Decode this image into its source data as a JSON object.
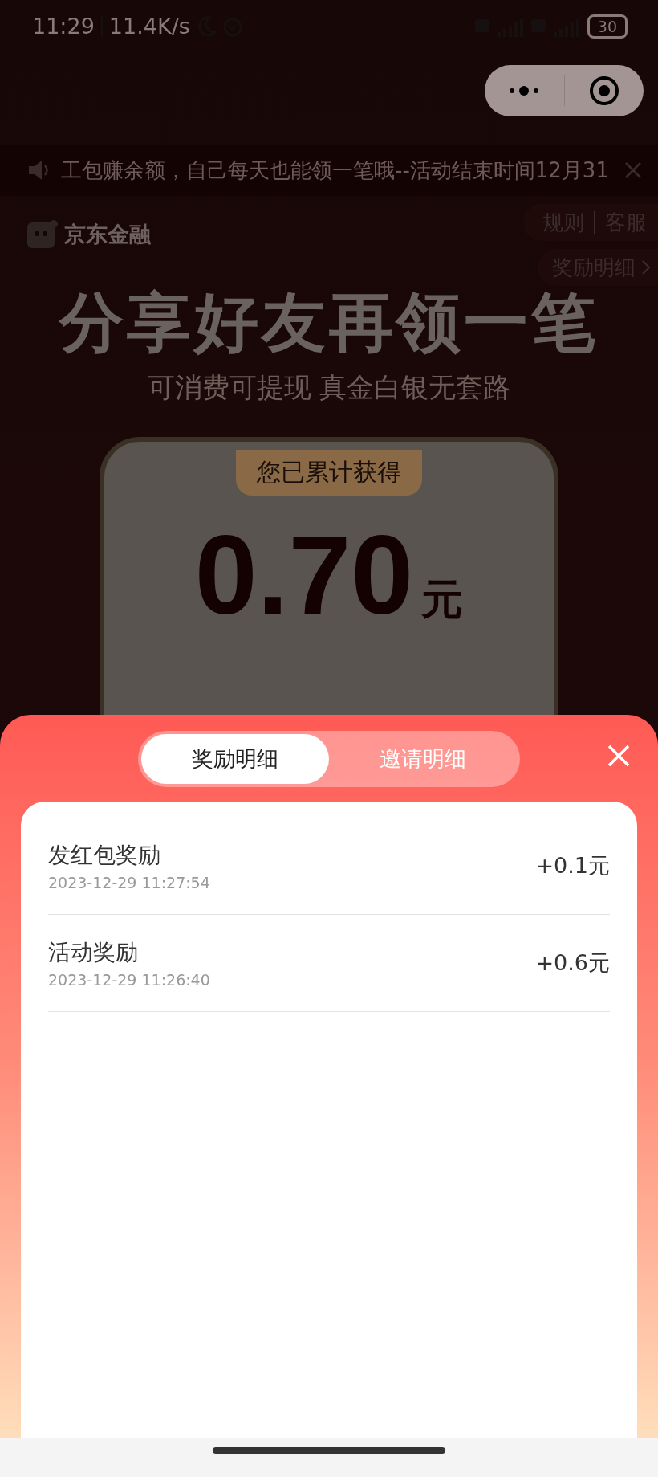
{
  "status_bar": {
    "time": "11:29",
    "speed": "11.4K/s",
    "battery": "30"
  },
  "notice": {
    "text": "工包赚余额，自己每天也能领一笔哦--活动结束时间12月31"
  },
  "header": {
    "brand": "京东金融",
    "links": [
      "规则",
      "客服"
    ],
    "detail_link": "奖励明细"
  },
  "hero": {
    "title": "分享好友再领一笔",
    "subtitle": "可消费可提现 真金白银无套路",
    "total_label": "您已累计获得",
    "total": "0.70",
    "unit": "元"
  },
  "sheet": {
    "tabs": [
      {
        "label": "奖励明细",
        "selected": true
      },
      {
        "label": "邀请明细",
        "selected": false
      }
    ],
    "records": [
      {
        "title": "发红包奖励",
        "time": "2023-12-29 11:27:54",
        "amount": "+0.1元"
      },
      {
        "title": "活动奖励",
        "time": "2023-12-29 11:26:40",
        "amount": "+0.6元"
      }
    ]
  }
}
